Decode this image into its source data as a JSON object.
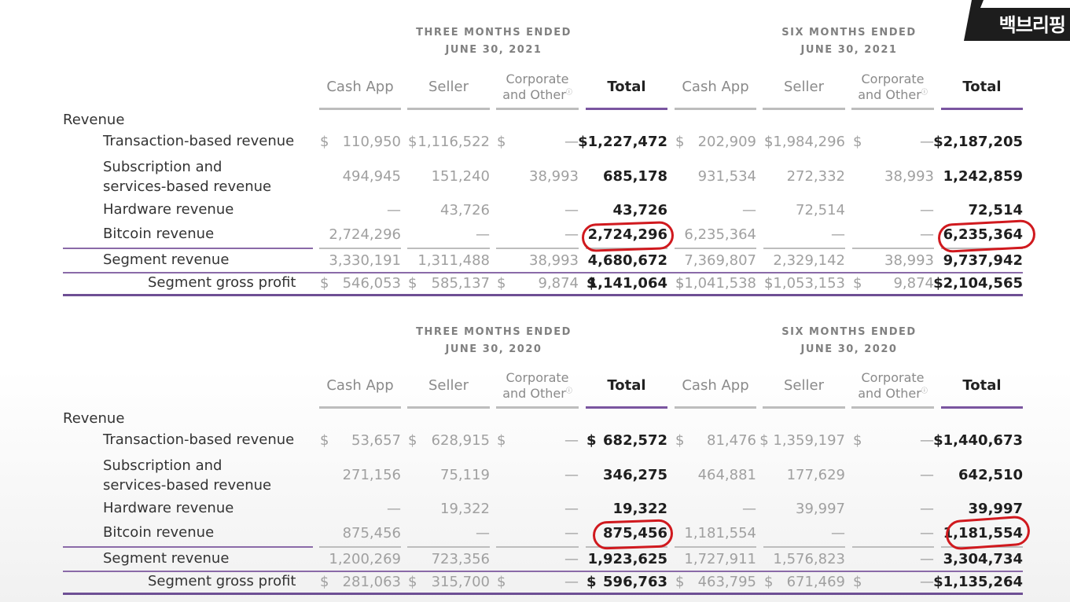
{
  "badge": {
    "text": "백브리핑"
  },
  "tables": [
    {
      "period_left": [
        "THREE MONTHS ENDED",
        "JUNE 30, 2021"
      ],
      "period_right": [
        "SIX MONTHS ENDED",
        "JUNE 30, 2021"
      ],
      "columns": [
        "Cash App",
        "Seller",
        "Corporate",
        "and Other",
        "Total"
      ],
      "section_label": "Revenue",
      "rows": [
        {
          "label": "Transaction-based revenue",
          "cur": [
            "$",
            "$",
            "$",
            "",
            "$",
            "$",
            "$",
            ""
          ],
          "values": [
            "110,950",
            "1,116,522",
            "—",
            "$1,227,472",
            "202,909",
            "$1,984,296",
            "—",
            "$2,187,205"
          ]
        },
        {
          "label1": "Subscription and",
          "label2": "services-based revenue",
          "values": [
            "494,945",
            "151,240",
            "38,993",
            "685,178",
            "931,534",
            "272,332",
            "38,993",
            "1,242,859"
          ]
        },
        {
          "label": "Hardware revenue",
          "values": [
            "—",
            "43,726",
            "—",
            "43,726",
            "—",
            "72,514",
            "—",
            "72,514"
          ]
        },
        {
          "label": "Bitcoin revenue",
          "values": [
            "2,724,296",
            "—",
            "—",
            "2,724,296",
            "6,235,364",
            "—",
            "—",
            "6,235,364"
          ]
        },
        {
          "label": "Segment revenue",
          "values": [
            "3,330,191",
            "1,311,488",
            "38,993",
            "4,680,672",
            "7,369,807",
            "2,329,142",
            "38,993",
            "9,737,942"
          ]
        },
        {
          "label": "Segment gross profit",
          "cur": [
            "$",
            "$",
            "$",
            "$",
            "$",
            "$",
            "$",
            ""
          ],
          "values": [
            "546,053",
            "585,137",
            "9,874",
            "1,141,064",
            "$1,041,538",
            "$1,053,153",
            "9,874",
            "$2,104,565"
          ]
        }
      ]
    },
    {
      "period_left": [
        "THREE MONTHS ENDED",
        "JUNE 30, 2020"
      ],
      "period_right": [
        "SIX MONTHS ENDED",
        "JUNE 30, 2020"
      ],
      "columns": [
        "Cash App",
        "Seller",
        "Corporate",
        "and Other",
        "Total"
      ],
      "section_label": "Revenue",
      "rows": [
        {
          "label": "Transaction-based revenue",
          "cur": [
            "$",
            "$",
            "$",
            "$",
            "$",
            "",
            "$",
            ""
          ],
          "values": [
            "53,657",
            "628,915",
            "—",
            "682,572",
            "81,476",
            "$ 1,359,197",
            "—",
            "$1,440,673"
          ]
        },
        {
          "label1": "Subscription and",
          "label2": "services-based revenue",
          "values": [
            "271,156",
            "75,119",
            "—",
            "346,275",
            "464,881",
            "177,629",
            "—",
            "642,510"
          ]
        },
        {
          "label": "Hardware revenue",
          "values": [
            "—",
            "19,322",
            "—",
            "19,322",
            "—",
            "39,997",
            "—",
            "39,997"
          ]
        },
        {
          "label": "Bitcoin revenue",
          "values": [
            "875,456",
            "—",
            "—",
            "875,456",
            "1,181,554",
            "—",
            "—",
            "1,181,554"
          ]
        },
        {
          "label": "Segment revenue",
          "values": [
            "1,200,269",
            "723,356",
            "—",
            "1,923,625",
            "1,727,911",
            "1,576,823",
            "—",
            "3,304,734"
          ]
        },
        {
          "label": "Segment gross profit",
          "cur": [
            "$",
            "$",
            "$",
            "$",
            "$",
            "$",
            "$",
            ""
          ],
          "values": [
            "281,063",
            "315,700",
            "—",
            "596,763",
            "463,795",
            "671,469",
            "—",
            "$1,135,264"
          ]
        }
      ]
    }
  ]
}
